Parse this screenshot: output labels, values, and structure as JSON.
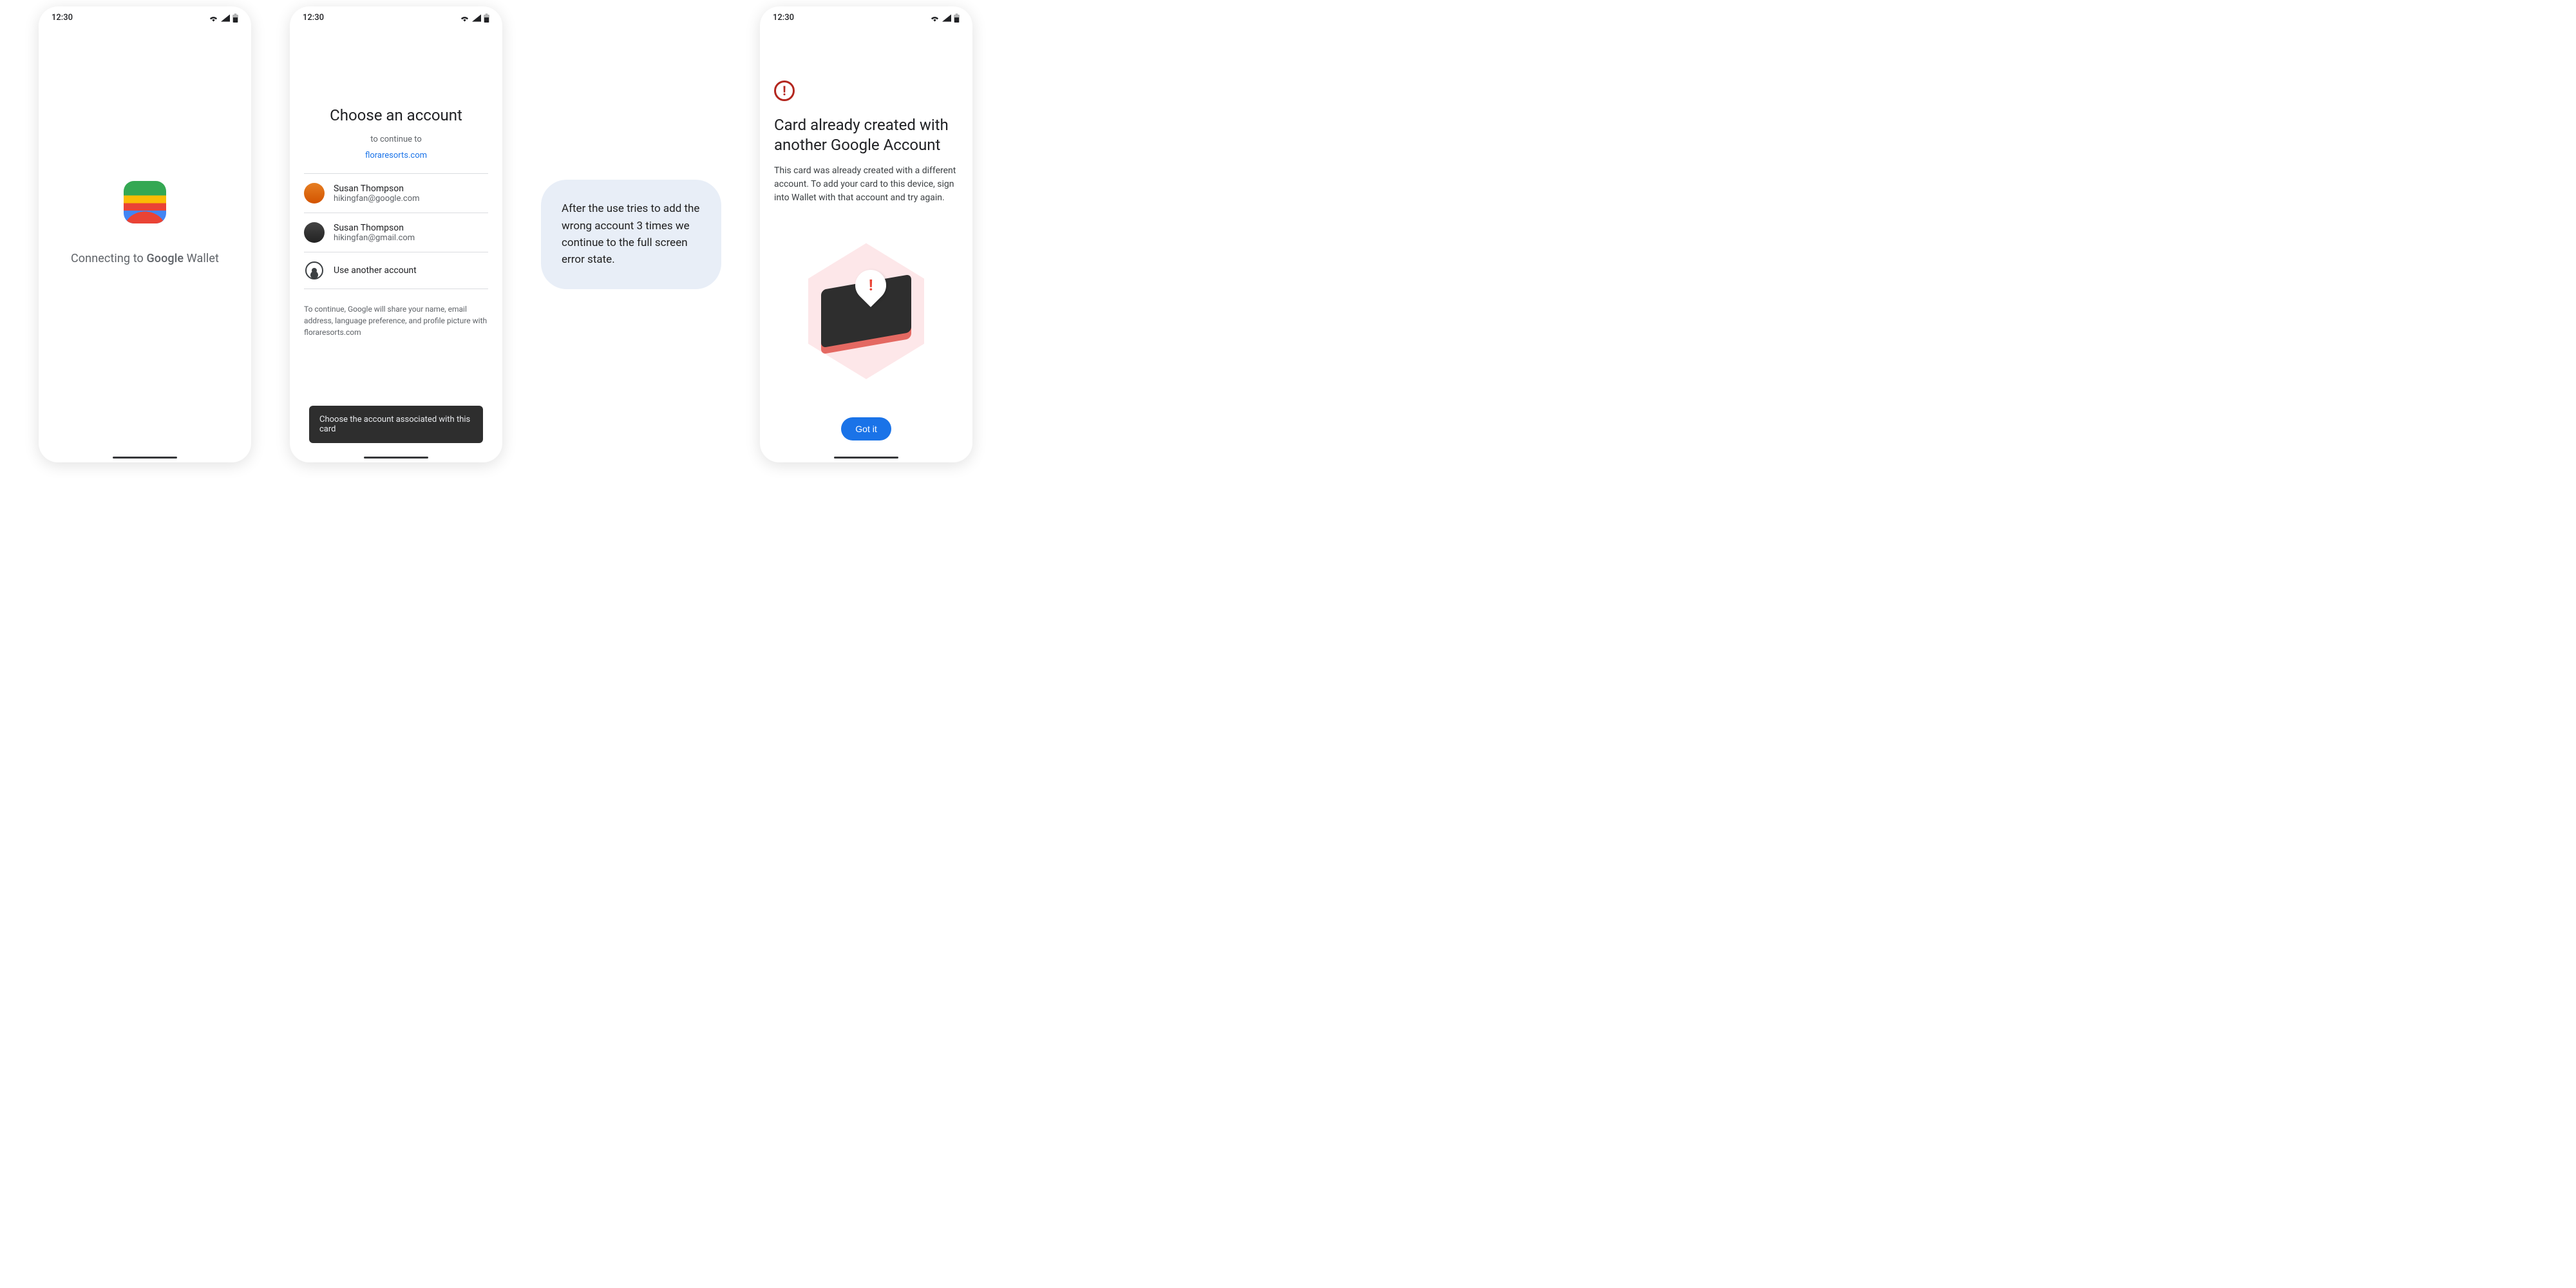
{
  "status": {
    "time": "12:30"
  },
  "screen1": {
    "connecting_prefix": "Connecting to ",
    "google": "Google",
    "wallet": " Wallet"
  },
  "screen2": {
    "title": "Choose an account",
    "subtitle": "to continue to",
    "domain_link": "floraresorts.com",
    "accounts": [
      {
        "name": "Susan Thompson",
        "email": "hikingfan@google.com"
      },
      {
        "name": "Susan Thompson",
        "email": "hikingfan@gmail.com"
      }
    ],
    "another_account_label": "Use another account",
    "disclaimer": "To continue, Google will share your name, email address, language preference, and profile picture with floraresorts.com",
    "toast": "Choose the account associated with this card"
  },
  "callout": {
    "text": "After the use tries to add the wrong account 3 times we continue to the full screen error state."
  },
  "screen3": {
    "title": "Card already created with another Google Account",
    "description": "This card was already created with a different account. To add your card to this device, sign into Wallet with that account and try again.",
    "button_label": "Got it"
  }
}
